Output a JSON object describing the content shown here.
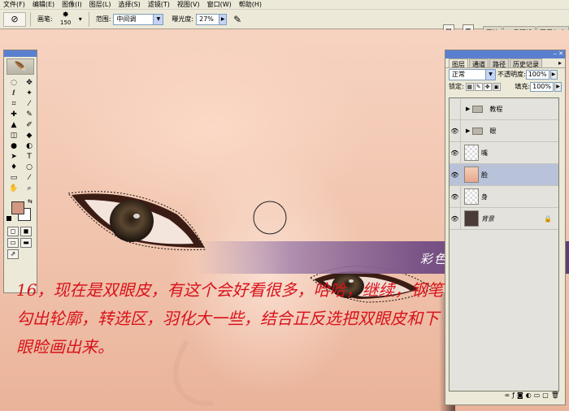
{
  "menu": [
    "文件(F)",
    "编辑(E)",
    "图像(I)",
    "图层(L)",
    "选择(S)",
    "滤镜(T)",
    "视图(V)",
    "窗口(W)",
    "帮助(H)"
  ],
  "options": {
    "brush_label": "画笔:",
    "brush_size": "150",
    "range_label": "范围:",
    "range_value": "中间调",
    "exposure_label": "曝光度:",
    "exposure_value": "27%"
  },
  "right_tabs": [
    "画笔",
    "工具预设",
    "图层复合"
  ],
  "watermark": "彩色铅笔-靖  原创教程",
  "layers_panel": {
    "tabs": [
      "图层",
      "通道",
      "路径",
      "历史记录"
    ],
    "blend_mode": "正常",
    "opacity_label": "不透明度:",
    "opacity_value": "100%",
    "lock_label": "锁定:",
    "fill_label": "填充:",
    "fill_value": "100%",
    "layers": [
      {
        "name": "教程",
        "type": "folder",
        "visible": false,
        "selected": false
      },
      {
        "name": "眼",
        "type": "folder",
        "visible": true,
        "selected": false
      },
      {
        "name": "嘴",
        "type": "layer",
        "visible": true,
        "selected": false
      },
      {
        "name": "脸",
        "type": "layer",
        "visible": true,
        "selected": true
      },
      {
        "name": "身",
        "type": "layer",
        "visible": true,
        "selected": false
      },
      {
        "name": "背景",
        "type": "background",
        "visible": true,
        "selected": false
      }
    ]
  },
  "caption": [
    "16，现在是双眼皮，有这个会好看很多，哈哈，继续，钢笔",
    "勾出轮廓，转选区，羽化大一些，结合正反选把双眼皮和下",
    "眼睑画出来。"
  ],
  "colors": {
    "foreground": "#d39882",
    "background": "#ffffff",
    "caption": "#d8121b"
  }
}
